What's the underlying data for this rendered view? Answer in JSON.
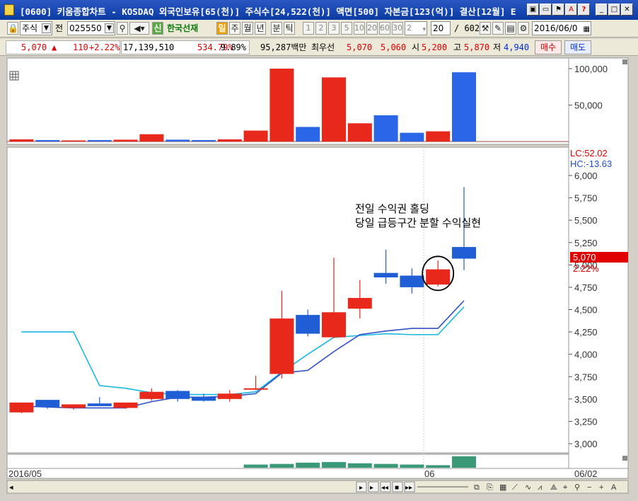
{
  "window": {
    "title": "[0600] 키움종합차트 - KOSDAQ 외국인보유[65(천)] 주식수[24,522(천)] 액면[500] 자본금[123(억)] 결산[12월] E",
    "buttons": [
      "min",
      "max",
      "close"
    ]
  },
  "toolbar": {
    "market": "주식",
    "prefix": "전",
    "code": "025550",
    "name_badge": "신",
    "company": "한국선재",
    "period_active": "일",
    "periods": [
      "주",
      "월",
      "년",
      "분",
      "틱"
    ],
    "minutes": [
      "1",
      "2",
      "3",
      "5",
      "10",
      "20",
      "60",
      "30",
      "2"
    ],
    "count": "20",
    "total": "/ 602",
    "date": "2016/06/0"
  },
  "pricebar": {
    "price": "5,070",
    "arrow": "▲",
    "change": "110",
    "change_pct": "+2.22%",
    "volume": "17,139,510",
    "volume_ratio": "534.79%",
    "turnover": "9.89%",
    "amount": "95,287백만",
    "best_label": "최우선",
    "ask": "5,070",
    "bid": "5,060",
    "open_label": "시",
    "open": "5,200",
    "high_label": "고",
    "high": "5,870",
    "low_label": "저",
    "low": "4,940",
    "buy_button": "매수",
    "sell_button": "매도"
  },
  "chart_data": [
    {
      "type": "bar",
      "panel": "volume",
      "ylim": [
        0,
        120000
      ],
      "y_ticks": [
        "100,000",
        "50,000"
      ],
      "values": [
        3000,
        2000,
        1500,
        2000,
        2500,
        10000,
        2500,
        2000,
        3000,
        15000,
        100000,
        20000,
        88000,
        25000,
        36000,
        12000,
        14000,
        95000
      ],
      "colors": [
        "red",
        "blue",
        "red",
        "blue",
        "red",
        "red",
        "blue",
        "blue",
        "red",
        "red",
        "red",
        "blue",
        "red",
        "red",
        "blue",
        "blue",
        "red",
        "blue"
      ]
    },
    {
      "type": "candlestick",
      "panel": "price",
      "ylim": [
        2900,
        6150
      ],
      "y_ticks": [
        "6,000",
        "5,750",
        "5,500",
        "5,250",
        "5,000",
        "4,750",
        "4,500",
        "4,250",
        "4,000",
        "3,750",
        "3,500",
        "3,250",
        "3,000"
      ],
      "x_labels": [
        "2016/05",
        "06",
        "06/02"
      ],
      "legend": [
        "LC:52.02",
        "HC:-13.63"
      ],
      "current_price": "5,070",
      "current_pct": "2.22%",
      "annotation": [
        "전일 수익권 홀딩",
        "당일 급등구간 분할 수익실현"
      ],
      "candles": [
        {
          "o": 3350,
          "h": 3460,
          "l": 3340,
          "c": 3460
        },
        {
          "o": 3490,
          "h": 3490,
          "l": 3390,
          "c": 3410
        },
        {
          "o": 3400,
          "h": 3440,
          "l": 3380,
          "c": 3440
        },
        {
          "o": 3450,
          "h": 3520,
          "l": 3420,
          "c": 3420
        },
        {
          "o": 3400,
          "h": 3460,
          "l": 3390,
          "c": 3460
        },
        {
          "o": 3500,
          "h": 3620,
          "l": 3480,
          "c": 3580
        },
        {
          "o": 3590,
          "h": 3600,
          "l": 3470,
          "c": 3500
        },
        {
          "o": 3520,
          "h": 3560,
          "l": 3470,
          "c": 3480
        },
        {
          "o": 3500,
          "h": 3600,
          "l": 3470,
          "c": 3560
        },
        {
          "o": 3620,
          "h": 3760,
          "l": 3600,
          "c": 3620
        },
        {
          "o": 3780,
          "h": 4710,
          "l": 3730,
          "c": 4400
        },
        {
          "o": 4440,
          "h": 4500,
          "l": 4200,
          "c": 4230
        },
        {
          "o": 4190,
          "h": 5080,
          "l": 4180,
          "c": 4470
        },
        {
          "o": 4510,
          "h": 4830,
          "l": 4400,
          "c": 4630
        },
        {
          "o": 4910,
          "h": 5170,
          "l": 4790,
          "c": 4860
        },
        {
          "o": 4880,
          "h": 4960,
          "l": 4680,
          "c": 4750
        },
        {
          "o": 4780,
          "h": 5050,
          "l": 4760,
          "c": 4950
        },
        {
          "o": 5200,
          "h": 5870,
          "l": 4940,
          "c": 5070
        }
      ],
      "highlight_index": 16,
      "ma_blue": [
        3420,
        3410,
        3400,
        3400,
        3400,
        3470,
        3520,
        3520,
        3530,
        3560,
        3790,
        3820,
        4030,
        4220,
        4260,
        4290,
        4290,
        4600
      ],
      "ma_cyan": [
        4250,
        4250,
        4250,
        3650,
        3620,
        3570,
        3550,
        3550,
        3550,
        3580,
        3800,
        4000,
        4190,
        4210,
        4230,
        4220,
        4220,
        4530
      ],
      "macd": [
        0,
        0,
        0,
        0,
        0,
        0,
        0,
        0,
        0,
        5,
        6,
        8,
        9,
        7,
        6,
        5,
        4,
        18
      ]
    }
  ],
  "bottom_bar": {
    "controls": [
      "◂",
      "▸",
      "◂◂",
      "■",
      "▸▸"
    ]
  }
}
